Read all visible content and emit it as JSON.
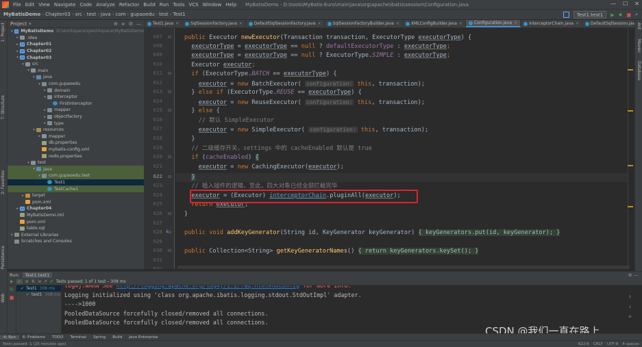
{
  "menu": {
    "items": [
      "File",
      "Edit",
      "View",
      "Navigate",
      "Code",
      "Analyze",
      "Refactor",
      "Build",
      "Run",
      "Tools",
      "VCS",
      "Window",
      "Help"
    ],
    "window_title": "MyBatisDemo - D:\\tools\\MyBatis-Euro\\main\\java\\org\\apache\\ibatis\\session\\Configuration.java"
  },
  "breadcrumb": [
    "MyBatisDemo",
    "Chapter03",
    "src",
    "test",
    "java",
    "com",
    "gupaoedu",
    "test",
    "Test1"
  ],
  "run_config": "Test1.test1",
  "project": {
    "header": "Project",
    "rows": [
      {
        "label": "MyBatisDemo",
        "extra": "D:\\workspace\\ipworkspace\\MyBatisDemo",
        "indent": 0,
        "arrow": "▾",
        "icon": "f-mod",
        "bold": true
      },
      {
        "label": ".idea",
        "indent": 1,
        "arrow": "▸",
        "icon": "f-folder"
      },
      {
        "label": "Chapter01",
        "indent": 1,
        "arrow": "▸",
        "icon": "f-mod",
        "bold": true
      },
      {
        "label": "Chapter02",
        "indent": 1,
        "arrow": "▸",
        "icon": "f-mod",
        "bold": true
      },
      {
        "label": "Chapter03",
        "indent": 1,
        "arrow": "▾",
        "icon": "f-mod",
        "bold": true
      },
      {
        "label": "src",
        "indent": 2,
        "arrow": "▾",
        "icon": "f-folder"
      },
      {
        "label": "main",
        "indent": 3,
        "arrow": "▾",
        "icon": "f-folder"
      },
      {
        "label": "java",
        "indent": 4,
        "arrow": "▾",
        "icon": "f-src"
      },
      {
        "label": "com.gupaoedu",
        "indent": 5,
        "arrow": "▾",
        "icon": "f-pkg"
      },
      {
        "label": "domain",
        "indent": 6,
        "arrow": "▸",
        "icon": "f-pkg"
      },
      {
        "label": "interceptor",
        "indent": 6,
        "arrow": "▾",
        "icon": "f-pkg"
      },
      {
        "label": "FirstInterceptor",
        "indent": 7,
        "arrow": "",
        "icon": "f-java"
      },
      {
        "label": "mapper",
        "indent": 6,
        "arrow": "▸",
        "icon": "f-pkg"
      },
      {
        "label": "objectfactory",
        "indent": 6,
        "arrow": "▸",
        "icon": "f-pkg"
      },
      {
        "label": "type",
        "indent": 6,
        "arrow": "▸",
        "icon": "f-pkg"
      },
      {
        "label": "resources",
        "indent": 4,
        "arrow": "▾",
        "icon": "f-res"
      },
      {
        "label": "mapper",
        "indent": 5,
        "arrow": "▸",
        "icon": "f-folder"
      },
      {
        "label": "db.properties",
        "indent": 5,
        "arrow": "",
        "icon": "f-prop"
      },
      {
        "label": "mybatis-config.xml",
        "indent": 5,
        "arrow": "",
        "icon": "f-xml"
      },
      {
        "label": "redis.properties",
        "indent": 5,
        "arrow": "",
        "icon": "f-prop"
      },
      {
        "label": "test",
        "indent": 3,
        "arrow": "▾",
        "icon": "f-folder"
      },
      {
        "label": "java",
        "indent": 4,
        "arrow": "▾",
        "icon": "f-src",
        "hl": true
      },
      {
        "label": "com.gupaoedu.test",
        "indent": 5,
        "arrow": "▾",
        "icon": "f-pkg",
        "hl": true
      },
      {
        "label": "Test1",
        "indent": 6,
        "arrow": "",
        "icon": "f-java",
        "sel": true
      },
      {
        "label": "TestCache1",
        "indent": 6,
        "arrow": "",
        "icon": "f-java",
        "hl": true
      },
      {
        "label": "target",
        "indent": 2,
        "arrow": "▸",
        "icon": "f-target"
      },
      {
        "label": "pom.xml",
        "indent": 2,
        "arrow": "",
        "icon": "f-xml"
      },
      {
        "label": "Chapter04",
        "indent": 1,
        "arrow": "▸",
        "icon": "f-mod",
        "bold": true
      },
      {
        "label": "MyBatisDemo.iml",
        "indent": 1,
        "arrow": "",
        "icon": "f-prop"
      },
      {
        "label": "pom.xml",
        "indent": 1,
        "arrow": "",
        "icon": "f-xml"
      },
      {
        "label": "table.sql",
        "indent": 1,
        "arrow": "",
        "icon": "f-prop"
      },
      {
        "label": "External Libraries",
        "indent": 0,
        "arrow": "▸",
        "icon": "f-lib"
      },
      {
        "label": "Scratches and Consoles",
        "indent": 0,
        "arrow": "",
        "icon": "f-lib"
      }
    ]
  },
  "tabs": [
    {
      "label": "Test1.java"
    },
    {
      "label": "SqlSessionFactory.java"
    },
    {
      "label": "DefaultSqlSessionFactory.java"
    },
    {
      "label": "SqlSessionFactoryBuilder.java"
    },
    {
      "label": "XMLConfigBuilder.java"
    },
    {
      "label": "Configuration.java",
      "active": true
    },
    {
      "label": "InterceptorChain.java"
    },
    {
      "label": "DefaultSqlSession.java"
    }
  ],
  "editor": {
    "line_numbers": [
      "607",
      "608",
      "609",
      "610",
      "611",
      "612",
      "613",
      "614",
      "615",
      "616",
      "617",
      "618",
      "619",
      "620",
      "621",
      "622",
      "623",
      "624",
      "625",
      "626",
      "627",
      "628",
      "629",
      "630",
      "631",
      "632"
    ],
    "current_line": "622",
    "tokens": {
      "public": "public",
      "executor_type": "Executor",
      "new_executor": "newExecutor",
      "params": "(Transaction transaction, ExecutorType ",
      "param_name": "executorType",
      "brace_open": ") {",
      "et": "executorType",
      "assign": " = ",
      "eq": " == ",
      "null_kw": "null",
      "q": " ? ",
      "default_et": "defaultExecutorType",
      "colon": " : ",
      "semi": ";",
      "simple": "SIMPLE",
      "batch": "BATCH",
      "reuse": "REUSE",
      "executor_word": "executor",
      "new_kw": "new",
      "if_kw": "if",
      "else_kw": "else",
      "batch_exec": "BatchExecutor",
      "reuse_exec": "ReuseExecutor",
      "simple_exec": "SimpleExecutor",
      "caching_exec": "CachingExecutor",
      "hint_config": "configuration:",
      "this_kw": "this",
      "transaction": "transaction",
      "return_kw": "return",
      "comment_simple": "// 默认 SimpleExecutor",
      "comment_cache": "// 二级缓存开关，settings 中的 cacheEnabled 默认是 true",
      "comment_plugin": "// 植入插件的逻辑，至此，四大对象已经全部拦截完毕",
      "cache_enabled": "cacheEnabled",
      "cast": "(Executor) ",
      "chain": "interceptorChain",
      "plugin_all": ".pluginAll(",
      "void_kw": "void",
      "add_key_gen": "addKeyGenerator",
      "akg_params": "(String id, KeyGenerator keyGenerator) ",
      "akg_body": "{ keyGenerators.put(id, keyGenerator); }",
      "collection": "Collection<String> ",
      "get_key_names": "getKeyGeneratorNames",
      "gkn_params": "() ",
      "gkn_body": "{ return keyGenerators.keySet(); }"
    }
  },
  "run": {
    "label": "Run:",
    "tab": "Test1.test1",
    "passed": "Tests passed: 1 of 1 test – 308 ms",
    "tree": [
      {
        "label": "Test1",
        "time": "308 ms"
      },
      {
        "label": "test1",
        "time": "308 ms"
      }
    ],
    "console": [
      {
        "cls": "warn",
        "prefix": "log4j:WARN See ",
        "url": "http://logging.apache.org/log4j/1.2/faq.html#noconfig",
        "suffix": " for more info."
      },
      {
        "text": "Logging initialized using 'class org.apache.ibatis.logging.stdout.StdOutImplˈ adapter."
      },
      {
        "text": "---->1000"
      },
      {
        "text": "PooledDataSource forcefully closed/removed all connections."
      },
      {
        "text": "PooledDataSource forcefully closed/removed all connections."
      }
    ]
  },
  "bottom_tabs": [
    "4: Run",
    "6: Problems",
    "TODO",
    "Terminal",
    "Spring",
    "Build",
    "Java Enterprise"
  ],
  "status": {
    "left": "Tests passed: 1 (25 minutes ago)",
    "right": [
      "622:6",
      "CRLF",
      "UTF-8",
      "4 spaces"
    ]
  },
  "left_tools": [
    "1: Project",
    "7: Structure",
    "2: Favorites",
    "Persistence",
    "Web"
  ],
  "right_tools": [
    "Ant",
    "Maven",
    "Database"
  ],
  "watermark": "CSDN @我们一直在路上"
}
